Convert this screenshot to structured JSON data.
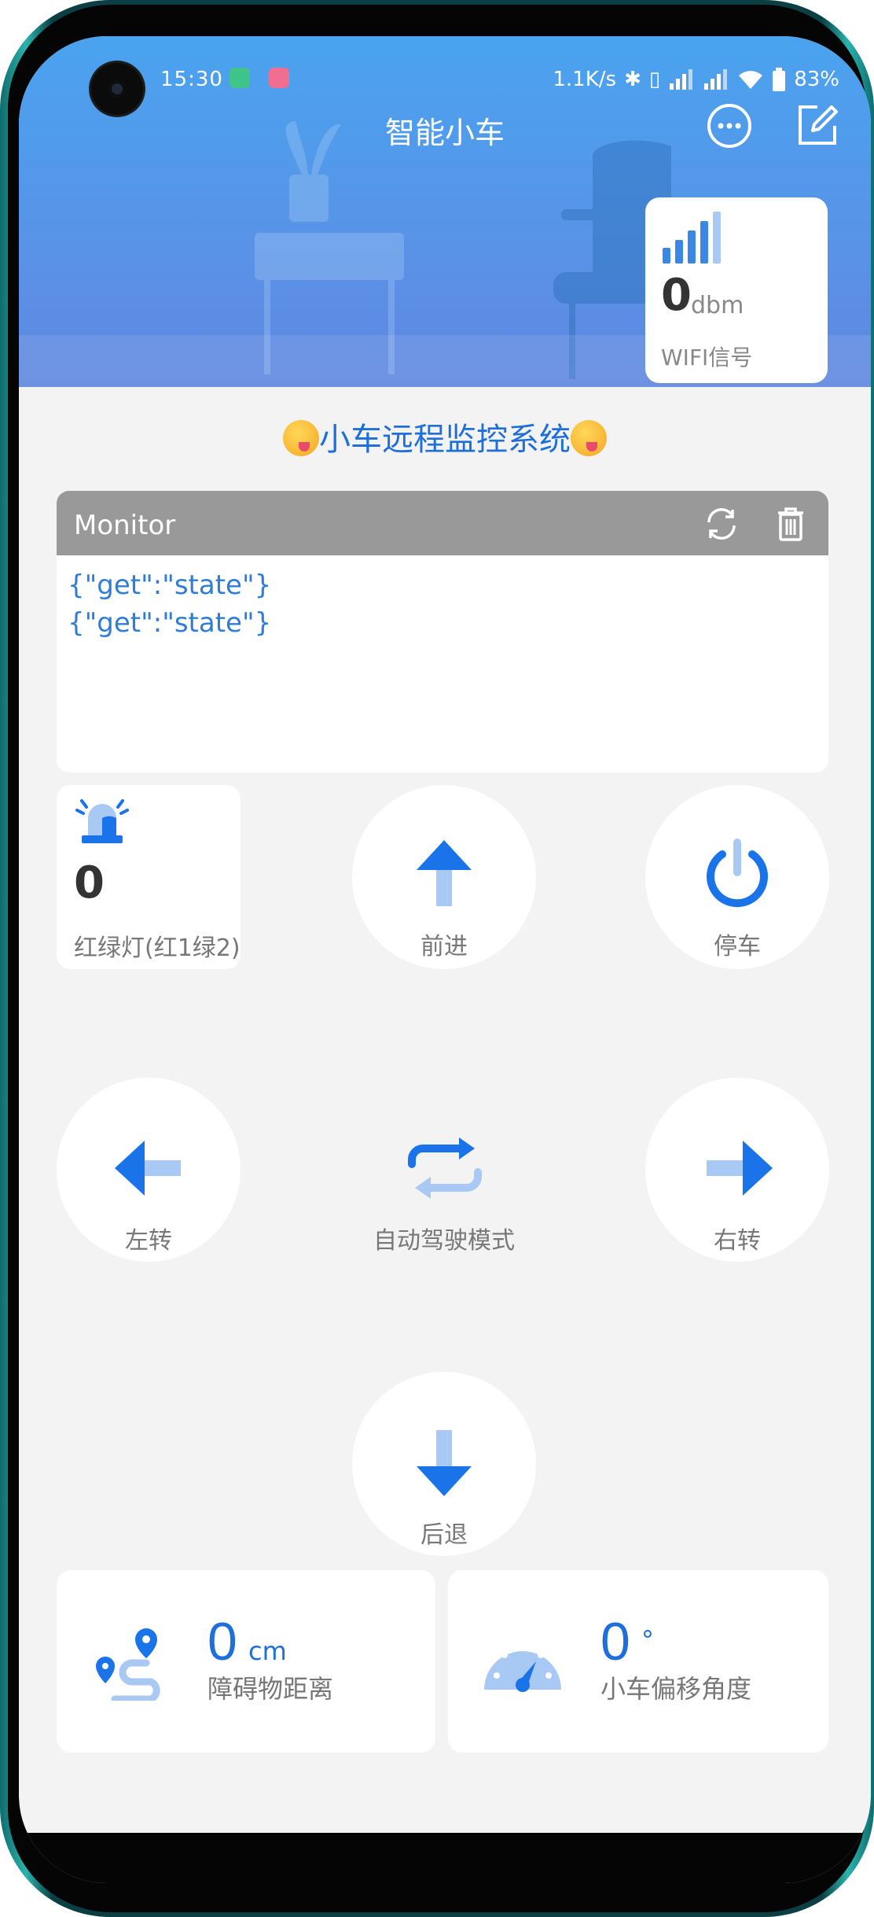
{
  "status_bar": {
    "time": "15:30",
    "net_speed": "1.1K/s",
    "battery": "83%"
  },
  "header": {
    "title": "智能小车"
  },
  "wifi_card": {
    "value": "0",
    "unit": "dbm",
    "label": "WIFI信号"
  },
  "system_title": "小车远程监控系统",
  "monitor": {
    "title": "Monitor",
    "lines": [
      "{\"get\":\"state\"}",
      "{\"get\":\"state\"}"
    ]
  },
  "traffic_light": {
    "value": "0",
    "label": "红绿灯(红1绿2)"
  },
  "controls": {
    "forward": "前进",
    "stop": "停车",
    "left": "左转",
    "auto": "自动驾驶模式",
    "right": "右转",
    "backward": "后退"
  },
  "sensors": {
    "distance": {
      "value": "0",
      "unit": "cm",
      "label": "障碍物距离"
    },
    "angle": {
      "value": "0",
      "unit": "°",
      "label": "小车偏移角度"
    }
  },
  "colors": {
    "accent": "#1e6fd9",
    "icon_blue": "#1a73e8",
    "icon_light": "#a9c9f5",
    "header_top": "#4aa3ef",
    "monitor_bar": "#999999"
  }
}
